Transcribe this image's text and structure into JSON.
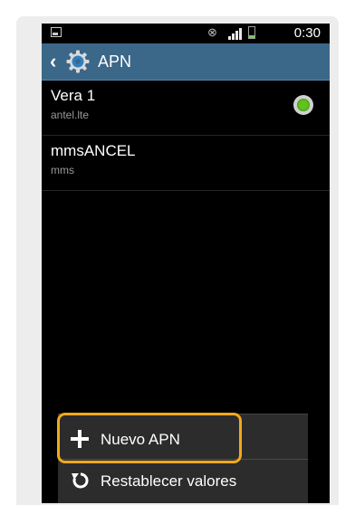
{
  "status_bar": {
    "time": "0:30",
    "icons": [
      "screenshot-icon",
      "eye-icon",
      "signal-icon",
      "battery-icon"
    ],
    "battery_color": "#6fd14a"
  },
  "action_bar": {
    "back_icon": "chevron-left-icon",
    "settings_icon": "gear-icon",
    "title": "APN",
    "color": "#3b6789"
  },
  "apn_list": [
    {
      "name": "Vera 1",
      "apn": "antel.lte",
      "selected": true
    },
    {
      "name": "mmsANCEL",
      "apn": "mms",
      "selected": false
    }
  ],
  "menu": {
    "items": [
      {
        "icon": "plus-icon",
        "label": "Nuevo APN",
        "highlighted": true
      },
      {
        "icon": "reset-icon",
        "label": "Restablecer valores",
        "highlighted": false
      }
    ],
    "highlight_color": "#f1a91c"
  }
}
